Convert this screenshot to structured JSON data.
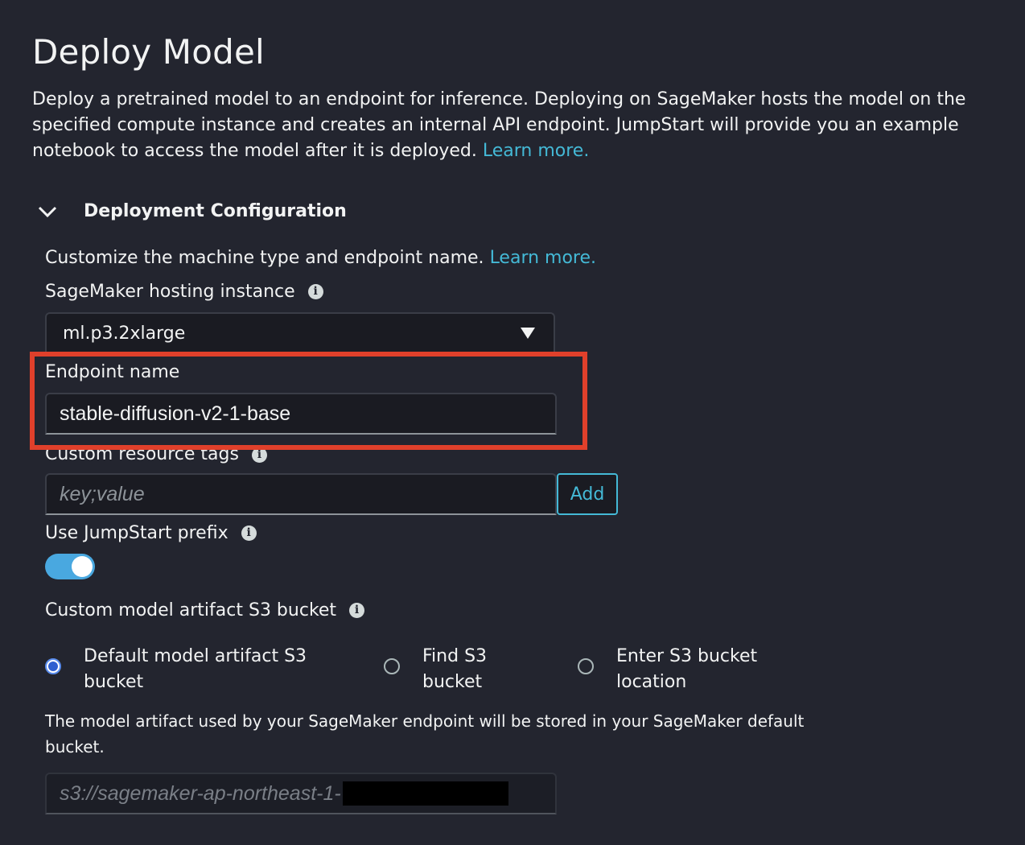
{
  "page": {
    "title": "Deploy Model",
    "description": "Deploy a pretrained model to an endpoint for inference. Deploying on SageMaker hosts the model on the specified compute instance and creates an internal API endpoint. JumpStart will provide you an example notebook to access the model after it is deployed.",
    "learn_more": "Learn more."
  },
  "section": {
    "title": "Deployment Configuration",
    "description": "Customize the machine type and endpoint name.",
    "learn_more": "Learn more."
  },
  "hosting_instance": {
    "label": "SageMaker hosting instance",
    "value": "ml.p3.2xlarge"
  },
  "endpoint": {
    "label": "Endpoint name",
    "value": "stable-diffusion-v2-1-base"
  },
  "tags": {
    "label": "Custom resource tags",
    "placeholder": "key;value",
    "add_label": "Add"
  },
  "prefix": {
    "label": "Use JumpStart prefix",
    "enabled": true
  },
  "s3": {
    "label": "Custom model artifact S3 bucket",
    "options": [
      {
        "label_line1": "Default model artifact S3",
        "label_line2": "bucket",
        "checked": true
      },
      {
        "label_line1": "Find S3",
        "label_line2": "bucket",
        "checked": false
      },
      {
        "label_line1": "Enter S3 bucket",
        "label_line2": "location",
        "checked": false
      }
    ],
    "note": "The model artifact used by your SageMaker endpoint will be stored in your SageMaker default bucket.",
    "path": "s3://sagemaker-ap-northeast-1-"
  },
  "colors": {
    "background": "#23252f",
    "link": "#44b9d6",
    "highlight": "#e0402b",
    "toggle": "#49a8e0"
  }
}
